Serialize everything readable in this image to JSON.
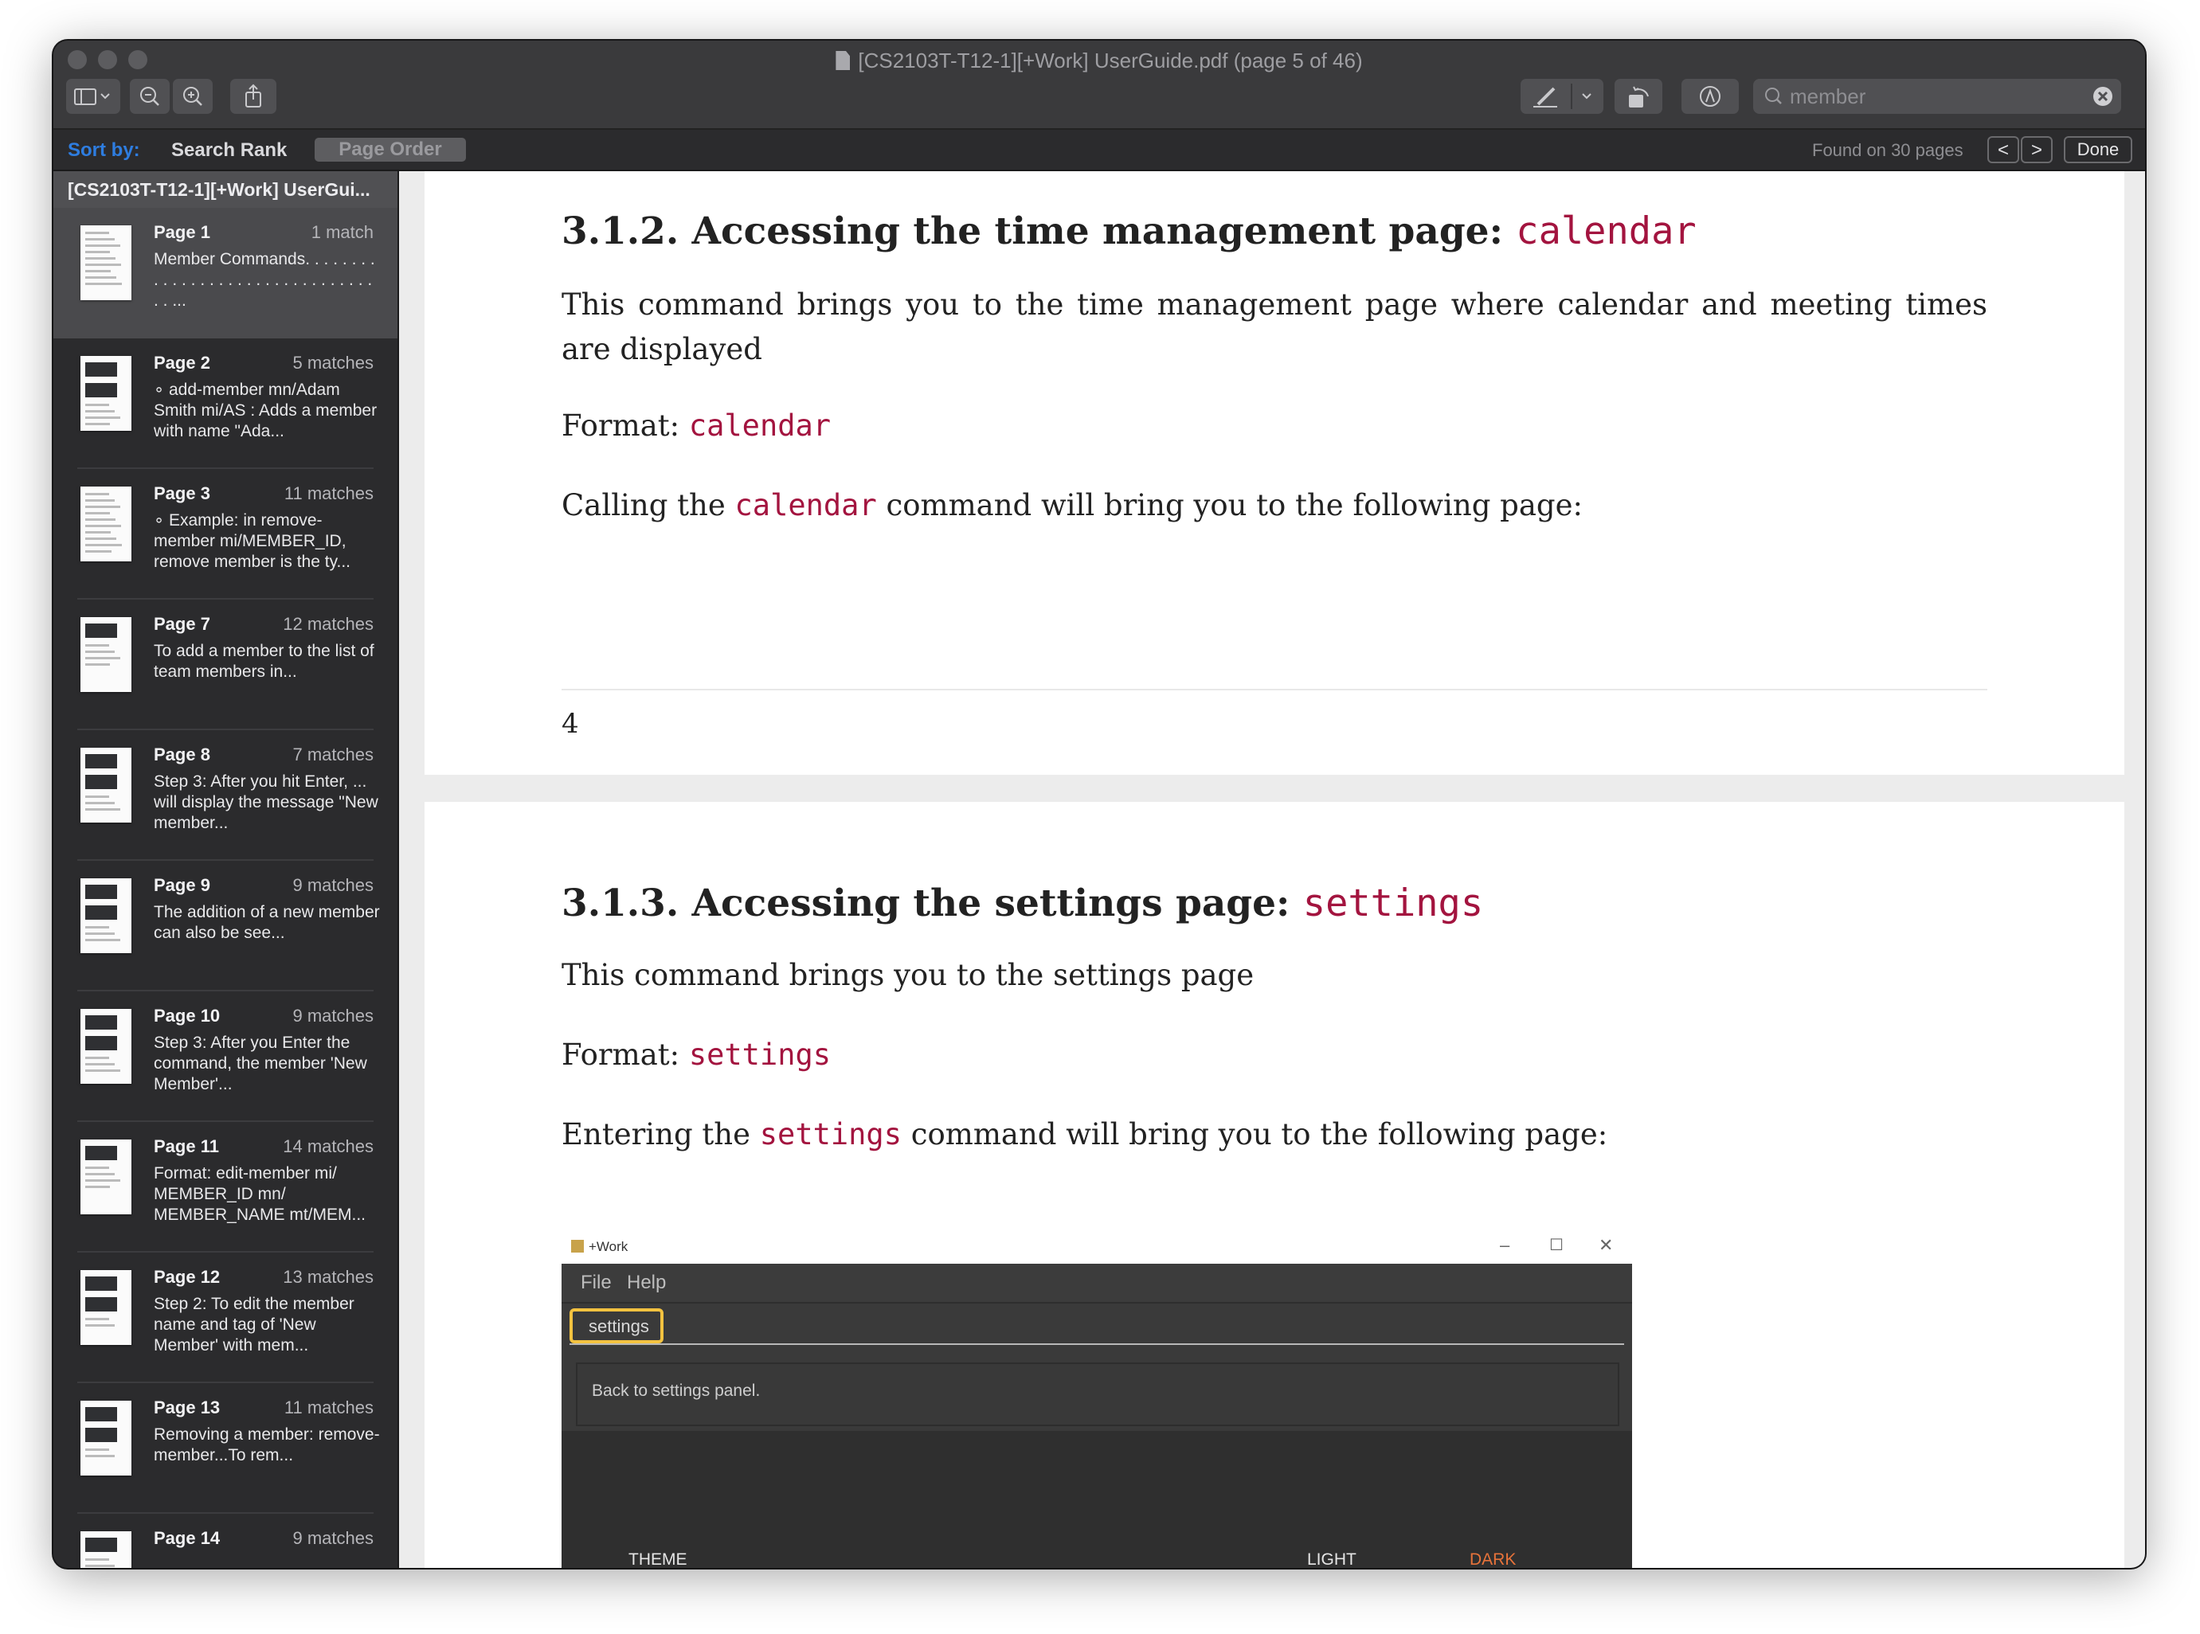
{
  "window": {
    "title": "[CS2103T-T12-1][+Work] UserGuide.pdf (page 5 of 46)"
  },
  "toolbar": {
    "search_value": "member"
  },
  "sortbar": {
    "sort_by": "Sort by:",
    "search_rank": "Search Rank",
    "page_order": "Page Order",
    "found": "Found on 30 pages",
    "prev": "<",
    "next": ">",
    "done": "Done"
  },
  "sidebar": {
    "document": "[CS2103T-T12-1][+Work] UserGui...",
    "results": [
      {
        "page": "Page 1",
        "count": "1 match",
        "snippet": "Member Commands. . . . . . . . . . . . . . . . . . . . . . . . . . . . . . . . . . ...",
        "selected": true
      },
      {
        "page": "Page 2",
        "count": "5 matches",
        "snippet": "∘ add-member mn/Adam Smith mi/AS : Adds a member with name \"Ada..."
      },
      {
        "page": "Page 3",
        "count": "11 matches",
        "snippet": "∘ Example: in remove-member mi/MEMBER_ID, remove member is the ty..."
      },
      {
        "page": "Page 7",
        "count": "12 matches",
        "snippet": "To add a member to the list of team members in..."
      },
      {
        "page": "Page 8",
        "count": "7 matches",
        "snippet": "Step 3: After you hit Enter, ... will display the message \"New member..."
      },
      {
        "page": "Page 9",
        "count": "9 matches",
        "snippet": "The addition of a new member can also be see..."
      },
      {
        "page": "Page 10",
        "count": "9 matches",
        "snippet": "Step 3: After you Enter the command, the member 'New Member'..."
      },
      {
        "page": "Page 11",
        "count": "14 matches",
        "snippet": "Format: edit-member mi/ MEMBER_ID mn/ MEMBER_NAME mt/MEM..."
      },
      {
        "page": "Page 12",
        "count": "13 matches",
        "snippet": "Step 2: To edit the member name and tag of 'New Member' with mem..."
      },
      {
        "page": "Page 13",
        "count": "11 matches",
        "snippet": "Removing a member: remove-member...To rem..."
      },
      {
        "page": "Page 14",
        "count": "9 matches",
        "snippet": ""
      }
    ]
  },
  "doc": {
    "page5": {
      "heading_text": "3.1.2. Accessing the time management page: ",
      "heading_code": "calendar",
      "para1": "This command brings you to the time management page where calendar and meeting times are displayed",
      "format_label": "Format: ",
      "format_code": "calendar",
      "calling_pre": "Calling the ",
      "calling_code": "calendar",
      "calling_post": " command will bring you to the following page:",
      "page_number": "4"
    },
    "page6": {
      "heading_text": "3.1.3. Accessing the settings page: ",
      "heading_code": "settings",
      "para1": "This command brings you to the settings page",
      "format_label": "Format: ",
      "format_code": "settings",
      "entering_pre": "Entering the ",
      "entering_code": "settings",
      "entering_post": " command will bring you to the following page:",
      "app": {
        "title": "+Work",
        "menu_file": "File",
        "menu_help": "Help",
        "command": "settings",
        "result": "Back to settings panel.",
        "theme_label": "THEME",
        "light": "LIGHT",
        "dark": "DARK"
      }
    }
  },
  "colors": {
    "code": "#a3143f",
    "accent_blue": "#2e7de0",
    "highlight_yellow": "#f3c240",
    "dark_orange": "#e8733a"
  }
}
